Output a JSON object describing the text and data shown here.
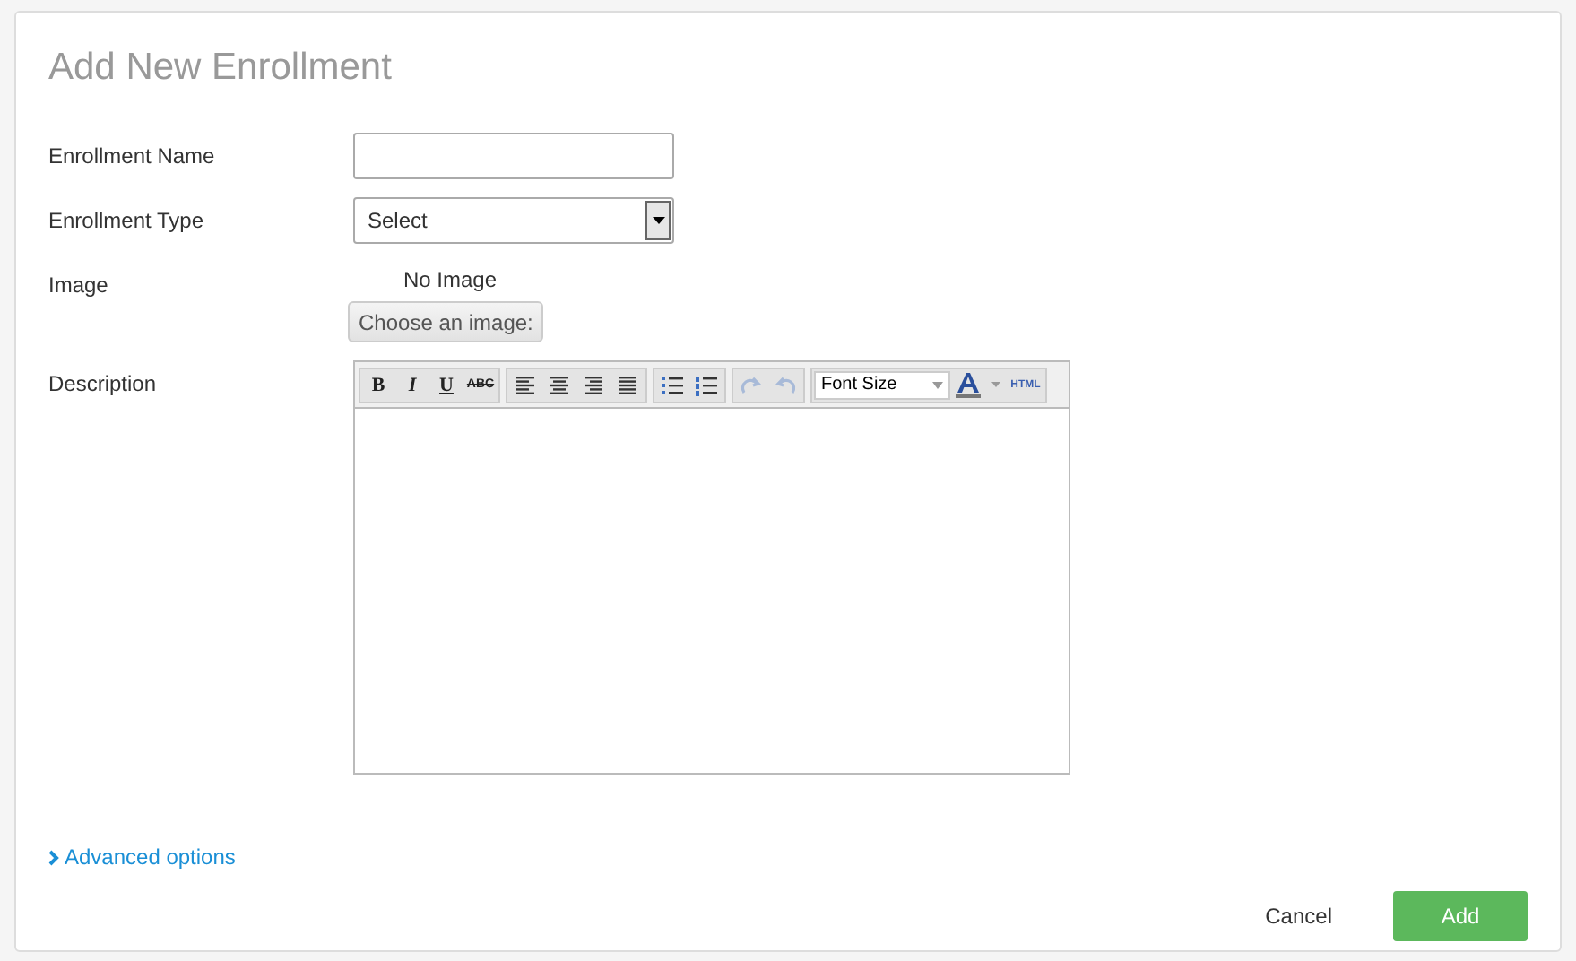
{
  "dialog": {
    "title": "Add New Enrollment"
  },
  "fields": [
    {
      "kind": "text",
      "label": "Enrollment Name"
    },
    {
      "kind": "select",
      "label": "Enrollment Type",
      "value": "Select"
    },
    {
      "kind": "image",
      "label": "Image",
      "status": "No Image",
      "button": "Choose an image:"
    },
    {
      "kind": "editor",
      "label": "Description"
    }
  ],
  "toolbar": [
    [
      {
        "kind": "bold",
        "label": "B",
        "disabled": false
      },
      {
        "kind": "italic",
        "label": "I",
        "disabled": false
      },
      {
        "kind": "underline",
        "label": "U",
        "disabled": false
      },
      {
        "kind": "strike",
        "label": "ABC",
        "disabled": false
      }
    ],
    [
      {
        "kind": "align-left",
        "disabled": false
      },
      {
        "kind": "align-center",
        "disabled": false
      },
      {
        "kind": "align-right",
        "disabled": false
      },
      {
        "kind": "justify",
        "disabled": false
      }
    ],
    [
      {
        "kind": "bullets",
        "disabled": false
      },
      {
        "kind": "numbers",
        "disabled": false
      }
    ],
    [
      {
        "kind": "redo",
        "disabled": true
      },
      {
        "kind": "undo",
        "disabled": true
      }
    ],
    [
      {
        "kind": "font-size",
        "label": "Font Size",
        "disabled": false
      },
      {
        "kind": "color",
        "disabled": false
      },
      {
        "kind": "html",
        "label": "HTML",
        "disabled": false
      }
    ]
  ],
  "advanced_link": "Advanced options",
  "buttons": [
    {
      "kind": "secondary",
      "label": "Cancel"
    },
    {
      "kind": "primary",
      "label": "Add"
    }
  ]
}
